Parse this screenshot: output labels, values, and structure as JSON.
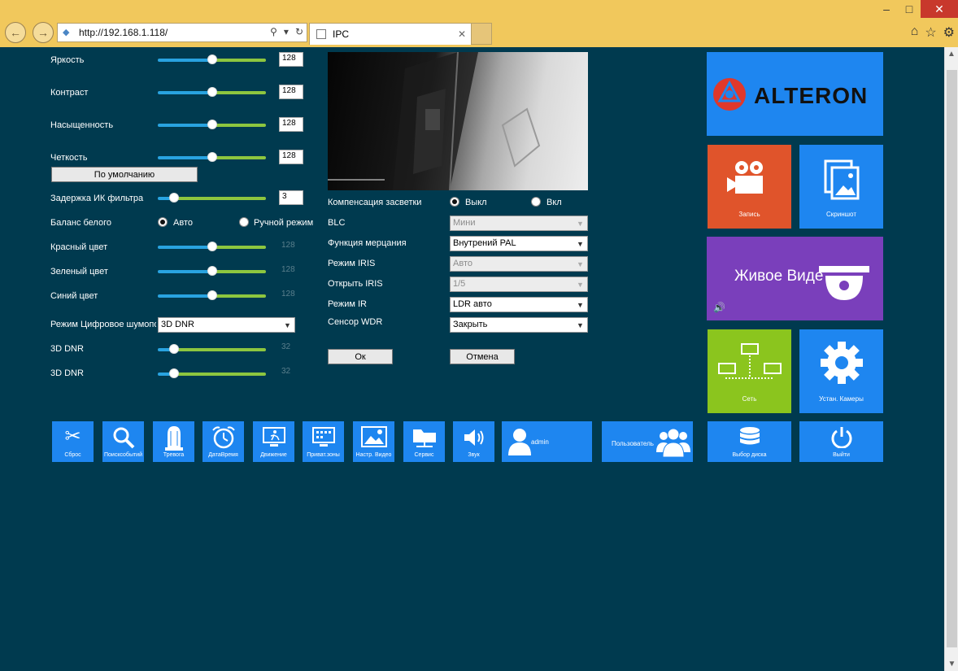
{
  "browser": {
    "url": "http://192.168.1.118/",
    "tab_title": "IPC",
    "window_buttons": [
      "–",
      "□",
      "✕"
    ],
    "nav_icons": [
      "back-icon",
      "forward-icon",
      "search-icon",
      "refresh-icon",
      "home-icon",
      "favorites-icon",
      "settings-icon"
    ]
  },
  "image_settings": {
    "brightness": {
      "label": "Яркость",
      "value": "128",
      "level": 0.5
    },
    "contrast": {
      "label": "Контраст",
      "value": "128",
      "level": 0.5
    },
    "saturation": {
      "label": "Насыщенность",
      "value": "128",
      "level": 0.5
    },
    "sharpness": {
      "label": "Четкость",
      "value": "128",
      "level": 0.5
    },
    "default_button": "По умолчанию",
    "ir_delay": {
      "label": "Задержка ИК фильтра",
      "value": "3",
      "level": 0.15
    },
    "white_balance": {
      "label": "Баланс белого",
      "options": [
        "Авто",
        "Ручной режим"
      ],
      "selected": "Авто"
    },
    "red": {
      "label": "Красный цвет",
      "value": "128",
      "level": 0.5
    },
    "green": {
      "label": "Зеленый цвет",
      "value": "128",
      "level": 0.5
    },
    "blue": {
      "label": "Синий цвет",
      "value": "128",
      "level": 0.5
    },
    "dnr_mode": {
      "label": "Режим Цифровое шумопод",
      "value": "3D DNR"
    },
    "dnr1": {
      "label": "3D DNR",
      "value": "32",
      "level": 0.15
    },
    "dnr2": {
      "label": "3D DNR",
      "value": "32",
      "level": 0.15
    }
  },
  "exposure_settings": {
    "backlight": {
      "label": "Компенсация засветки",
      "options": [
        "Выкл",
        "Вкл"
      ],
      "selected": "Выкл"
    },
    "blc": {
      "label": "BLC",
      "value": "Мини",
      "disabled": true
    },
    "flicker": {
      "label": "Функция мерцания",
      "value": "Внутрений PAL",
      "disabled": false
    },
    "iris_mode": {
      "label": "Режим IRIS",
      "value": "Авто",
      "disabled": true
    },
    "iris_open": {
      "label": "Открыть IRIS",
      "value": "1/5",
      "disabled": true
    },
    "ir_mode": {
      "label": "Режим IR",
      "value": "LDR авто",
      "disabled": false
    },
    "wdr": {
      "label": "Сенсор WDR",
      "value": "Закрыть",
      "disabled": false
    },
    "ok_button": "Ок",
    "cancel_button": "Отмена"
  },
  "tiles": {
    "brand": "ALTERON",
    "record": "Запись",
    "screenshot": "Скриншот",
    "live": "Живое Виде",
    "network": "Сеть",
    "camera_setup": "Устан. Камеры",
    "disk": "Выбор диска",
    "logout": "Выйти"
  },
  "toolbar": {
    "reset": "Сброс",
    "search": "Поисксобытий",
    "alarm": "Тревога",
    "datetime": "ДатаВремя",
    "motion": "Движение",
    "privacy": "Приват.зоны",
    "video": "Настр. Видео",
    "service": "Сервис",
    "sound": "Звук",
    "admin": "admin",
    "users": "Пользователь"
  },
  "colors": {
    "background": "#003a4f",
    "tile_blue": "#1e86f0",
    "tile_orange": "#e0542b",
    "tile_purple": "#7a3fbb",
    "tile_green": "#8bc51e",
    "slider_blue": "#29a3e0",
    "slider_green": "#8dc63f",
    "browser_frame": "#f1c85c"
  }
}
